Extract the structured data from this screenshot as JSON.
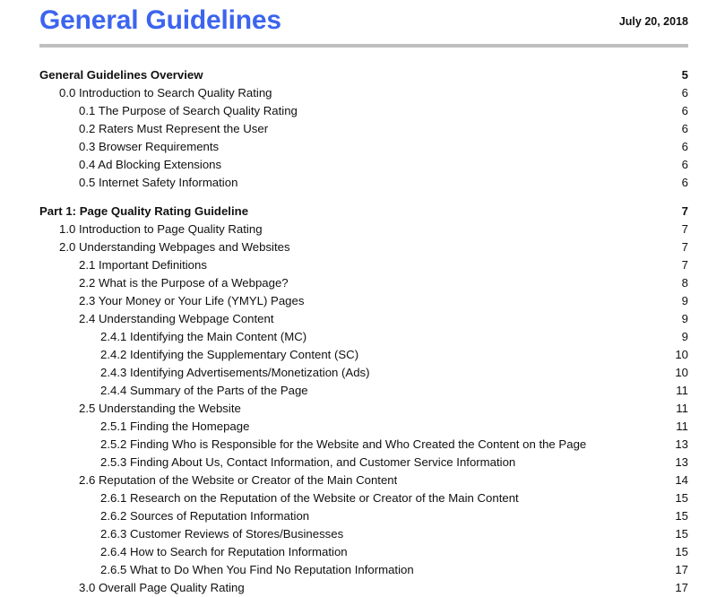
{
  "header": {
    "title": "General Guidelines",
    "date": "July 20, 2018",
    "title_color": "#3c64ef",
    "rule_color": "#bfbfbf"
  },
  "toc": {
    "entries": [
      {
        "label": "General Guidelines Overview",
        "page": "5",
        "level": 0,
        "bold": true,
        "gap_before": false
      },
      {
        "label": "0.0 Introduction to Search Quality Rating",
        "page": "6",
        "level": 1,
        "bold": false,
        "gap_before": false
      },
      {
        "label": "0.1 The Purpose of Search Quality Rating",
        "page": "6",
        "level": 2,
        "bold": false,
        "gap_before": false
      },
      {
        "label": "0.2 Raters Must Represent the User",
        "page": "6",
        "level": 2,
        "bold": false,
        "gap_before": false
      },
      {
        "label": "0.3 Browser Requirements",
        "page": "6",
        "level": 2,
        "bold": false,
        "gap_before": false
      },
      {
        "label": "0.4 Ad Blocking Extensions",
        "page": "6",
        "level": 2,
        "bold": false,
        "gap_before": false
      },
      {
        "label": "0.5 Internet Safety Information",
        "page": "6",
        "level": 2,
        "bold": false,
        "gap_before": false
      },
      {
        "label": "Part 1: Page Quality Rating Guideline",
        "page": "7",
        "level": 0,
        "bold": true,
        "gap_before": true
      },
      {
        "label": "1.0 Introduction to Page Quality Rating",
        "page": "7",
        "level": 1,
        "bold": false,
        "gap_before": false
      },
      {
        "label": "2.0 Understanding Webpages and Websites",
        "page": "7",
        "level": 1,
        "bold": false,
        "gap_before": false
      },
      {
        "label": "2.1 Important Definitions",
        "page": "7",
        "level": 2,
        "bold": false,
        "gap_before": false
      },
      {
        "label": "2.2 What is the Purpose of a Webpage?",
        "page": "8",
        "level": 2,
        "bold": false,
        "gap_before": false
      },
      {
        "label": "2.3 Your Money or Your Life (YMYL) Pages",
        "page": "9",
        "level": 2,
        "bold": false,
        "gap_before": false
      },
      {
        "label": "2.4 Understanding Webpage Content",
        "page": "9",
        "level": 2,
        "bold": false,
        "gap_before": false
      },
      {
        "label": "2.4.1 Identifying the Main Content (MC)",
        "page": "9",
        "level": 3,
        "bold": false,
        "gap_before": false
      },
      {
        "label": "2.4.2 Identifying the Supplementary Content (SC)",
        "page": "10",
        "level": 3,
        "bold": false,
        "gap_before": false
      },
      {
        "label": "2.4.3 Identifying Advertisements/Monetization (Ads)",
        "page": "10",
        "level": 3,
        "bold": false,
        "gap_before": false
      },
      {
        "label": "2.4.4 Summary of the Parts of the Page",
        "page": "11",
        "level": 3,
        "bold": false,
        "gap_before": false
      },
      {
        "label": "2.5 Understanding the Website",
        "page": "11",
        "level": 2,
        "bold": false,
        "gap_before": false
      },
      {
        "label": "2.5.1 Finding the Homepage",
        "page": "11",
        "level": 3,
        "bold": false,
        "gap_before": false
      },
      {
        "label": "2.5.2 Finding Who is Responsible for the Website and Who Created the Content on the Page",
        "page": "13",
        "level": 3,
        "bold": false,
        "gap_before": false
      },
      {
        "label": "2.5.3 Finding About Us, Contact Information, and Customer Service Information",
        "page": "13",
        "level": 3,
        "bold": false,
        "gap_before": false
      },
      {
        "label": "2.6 Reputation of the Website or Creator of the Main Content",
        "page": "14",
        "level": 2,
        "bold": false,
        "gap_before": false
      },
      {
        "label": "2.6.1 Research on the Reputation of the Website or Creator of the Main Content",
        "page": "15",
        "level": 3,
        "bold": false,
        "gap_before": false
      },
      {
        "label": "2.6.2 Sources of Reputation Information",
        "page": "15",
        "level": 3,
        "bold": false,
        "gap_before": false
      },
      {
        "label": "2.6.3 Customer Reviews of Stores/Businesses",
        "page": "15",
        "level": 3,
        "bold": false,
        "gap_before": false
      },
      {
        "label": "2.6.4 How to Search for Reputation Information",
        "page": "15",
        "level": 3,
        "bold": false,
        "gap_before": false
      },
      {
        "label": "2.6.5 What to Do When You Find No Reputation Information",
        "page": "17",
        "level": 3,
        "bold": false,
        "gap_before": false
      },
      {
        "label": "3.0 Overall Page Quality Rating",
        "page": "17",
        "level": 2,
        "bold": false,
        "gap_before": false
      }
    ]
  }
}
